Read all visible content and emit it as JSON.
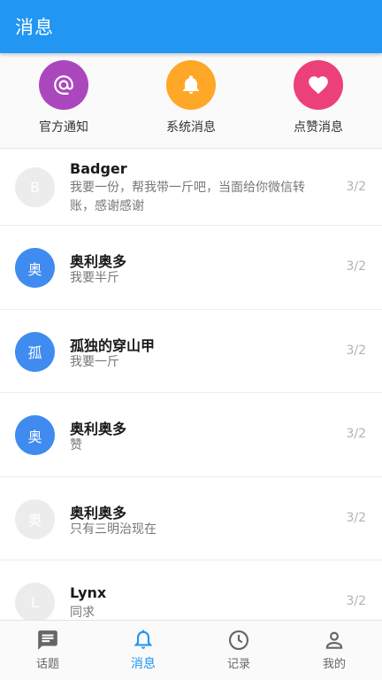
{
  "header": {
    "title": "消息"
  },
  "quick_actions": [
    {
      "label": "官方通知",
      "icon": "at-icon",
      "color": "#AB47BC"
    },
    {
      "label": "系统消息",
      "icon": "bell-icon",
      "color": "#FFA726"
    },
    {
      "label": "点赞消息",
      "icon": "heart-icon",
      "color": "#EC407A"
    }
  ],
  "messages": [
    {
      "avatar_text": "B",
      "avatar_style": "grey",
      "name": "Badger",
      "line1": "我要一份，帮我带一斤吧，当面给你微信转",
      "line2": "账，感谢感谢",
      "date": "3/2"
    },
    {
      "avatar_text": "奥",
      "avatar_style": "blue",
      "name": "奥利奥多",
      "line1": "我要半斤",
      "date": "3/2"
    },
    {
      "avatar_text": "孤",
      "avatar_style": "blue",
      "name": "孤独的穿山甲",
      "line1": "我要一斤",
      "date": "3/2"
    },
    {
      "avatar_text": "奥",
      "avatar_style": "blue",
      "name": "奥利奥多",
      "line1": "赞",
      "date": "3/2"
    },
    {
      "avatar_text": "奥",
      "avatar_style": "grey",
      "name": "奥利奥多",
      "line1": "只有三明治现在",
      "date": "3/2"
    },
    {
      "avatar_text": "L",
      "avatar_style": "grey",
      "name": "Lynx",
      "line1": "同求",
      "date": "3/2"
    }
  ],
  "bottom_nav": [
    {
      "label": "话题",
      "icon": "chat-icon",
      "active": false
    },
    {
      "label": "消息",
      "icon": "bell-icon",
      "active": true
    },
    {
      "label": "记录",
      "icon": "clock-icon",
      "active": false
    },
    {
      "label": "我的",
      "icon": "person-icon",
      "active": false
    }
  ],
  "colors": {
    "primary": "#2196F3",
    "avatar_blue": "#3F8BF0",
    "avatar_grey": "#ECECEC"
  }
}
